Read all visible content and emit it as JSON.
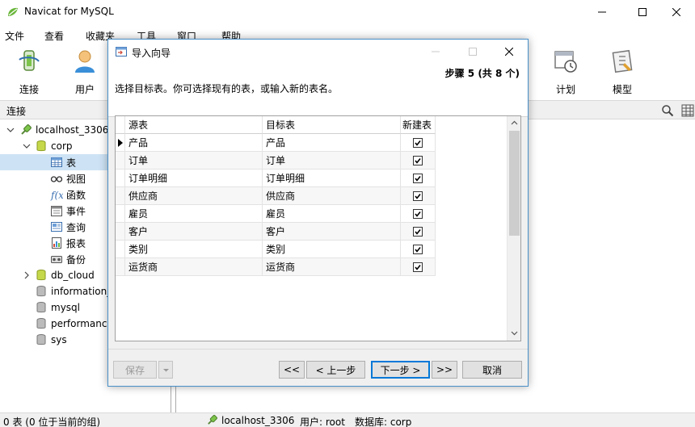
{
  "app": {
    "title": "Navicat for MySQL"
  },
  "menu": [
    "文件",
    "查看",
    "收藏夹",
    "工具",
    "窗口",
    "帮助"
  ],
  "toolbar": {
    "connect": "连接",
    "user": "用户",
    "schedule": "计划",
    "model": "模型"
  },
  "connbar": {
    "label": "连接"
  },
  "tree": {
    "connection": "localhost_3306",
    "db_open": "corp",
    "children": [
      "表",
      "视图",
      "函数",
      "事件",
      "查询",
      "报表",
      "备份"
    ],
    "databases": [
      "db_cloud",
      "information_",
      "mysql",
      "performanc",
      "sys"
    ]
  },
  "dialog": {
    "title": "导入向导",
    "step": "步骤 5 (共 8 个)",
    "instruction": "选择目标表。你可选择现有的表，或输入新的表名。",
    "columns": {
      "source": "源表",
      "target": "目标表",
      "new": "新建表"
    },
    "rows": [
      {
        "source": "产品",
        "target": "产品",
        "new": true
      },
      {
        "source": "订单",
        "target": "订单",
        "new": true
      },
      {
        "source": "订单明细",
        "target": "订单明细",
        "new": true
      },
      {
        "source": "供应商",
        "target": "供应商",
        "new": true
      },
      {
        "source": "雇员",
        "target": "雇员",
        "new": true
      },
      {
        "source": "客户",
        "target": "客户",
        "new": true
      },
      {
        "source": "类别",
        "target": "类别",
        "new": true
      },
      {
        "source": "运货商",
        "target": "运货商",
        "new": true
      }
    ],
    "buttons": {
      "save": "保存",
      "first": "<<",
      "prev": "< 上一步",
      "next": "下一步 >",
      "last": ">>",
      "cancel": "取消"
    }
  },
  "status": {
    "left": "0 表 (0 位于当前的组)",
    "connection": "localhost_3306",
    "user": "用户: root",
    "database": "数据库: corp"
  },
  "colors": {
    "accent": "#0078d7",
    "selection": "#cde3f5",
    "navicat_green": "#69b63a"
  }
}
